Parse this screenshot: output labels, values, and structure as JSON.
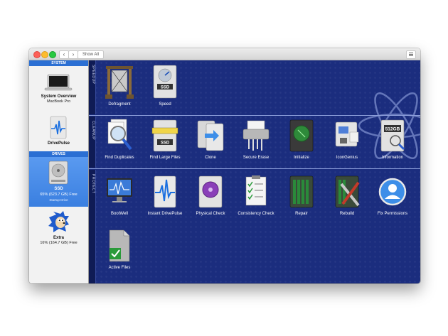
{
  "window": {
    "show_all_label": "Show All"
  },
  "sidebar": {
    "system_header": "SYSTEM",
    "drives_header": "DRIVES",
    "system_overview": {
      "name": "System Overview",
      "sub": "MacBook Pro"
    },
    "drivepulse": {
      "name": "DrivePulse"
    },
    "ssd": {
      "name": "SSD",
      "sub": "65% (623.7 GB) Free",
      "tiny": "Startup Drive"
    },
    "extra": {
      "name": "Extra",
      "sub": "16% (164.7 GB) Free"
    }
  },
  "sections": {
    "speedup": {
      "label": "SPEEDUP",
      "tiles": [
        "Defragment",
        "Speed"
      ]
    },
    "cleanup": {
      "label": "CLEANUP",
      "tiles": [
        "Find Duplicates",
        "Find Large Files",
        "Clone",
        "Secure Erase",
        "Initialize",
        "IconGenius",
        "Information"
      ]
    },
    "protect": {
      "label": "PROTECT",
      "tiles": [
        "BootWell",
        "Instant DrivePulse",
        "Physical Check",
        "Consistency Check",
        "Repair",
        "Rebuild",
        "Fix Permissions",
        "Active Files"
      ]
    }
  },
  "icon_text": {
    "ssd": "SSD",
    "size": "512GB"
  },
  "colors": {
    "background": "#1b2d7e",
    "accent": "#2b6fd3"
  }
}
